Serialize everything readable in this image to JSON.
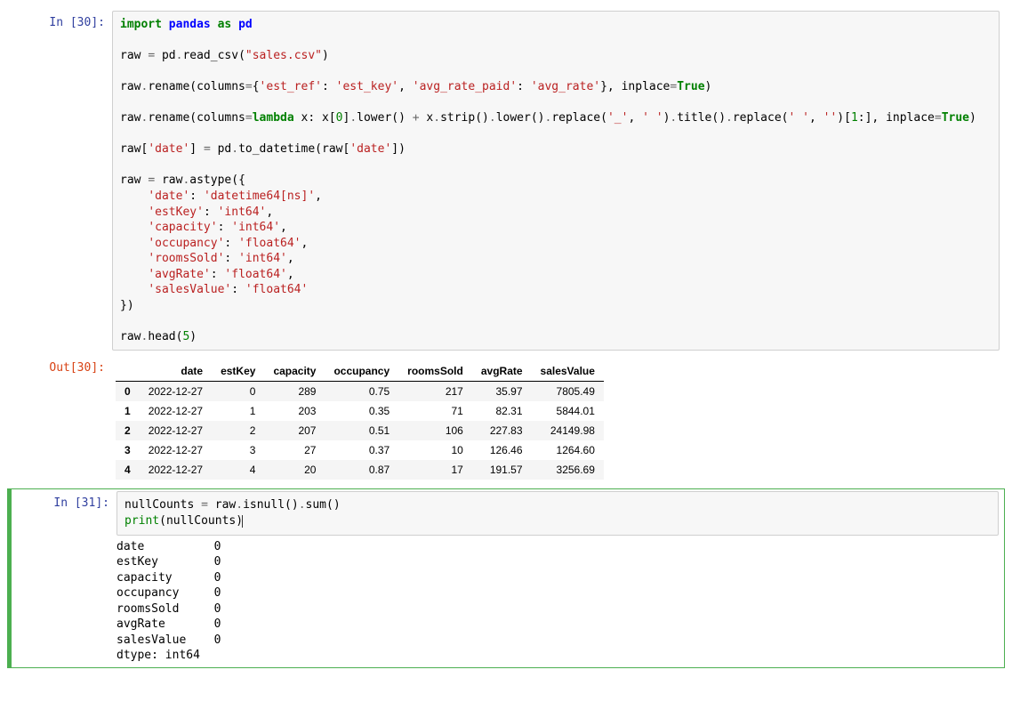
{
  "cells": [
    {
      "in_prompt": "In [30]:",
      "out_prompt": "Out[30]:",
      "code_tokens": [
        [
          "kw",
          "import"
        ],
        [
          "t",
          " "
        ],
        [
          "nn",
          "pandas"
        ],
        [
          "t",
          " "
        ],
        [
          "kw",
          "as"
        ],
        [
          "t",
          " "
        ],
        [
          "nn",
          "pd"
        ],
        [
          "nl",
          ""
        ],
        [
          "nl",
          ""
        ],
        [
          "t",
          "raw "
        ],
        [
          "op",
          "="
        ],
        [
          "t",
          " pd"
        ],
        [
          "op",
          "."
        ],
        [
          "t",
          "read_csv("
        ],
        [
          "str",
          "\"sales.csv\""
        ],
        [
          "t",
          ")"
        ],
        [
          "nl",
          ""
        ],
        [
          "nl",
          ""
        ],
        [
          "t",
          "raw"
        ],
        [
          "op",
          "."
        ],
        [
          "t",
          "rename(columns"
        ],
        [
          "op",
          "="
        ],
        [
          "t",
          "{"
        ],
        [
          "str",
          "'est_ref'"
        ],
        [
          "t",
          ": "
        ],
        [
          "str",
          "'est_key'"
        ],
        [
          "t",
          ", "
        ],
        [
          "str",
          "'avg_rate_paid'"
        ],
        [
          "t",
          ": "
        ],
        [
          "str",
          "'avg_rate'"
        ],
        [
          "t",
          "}, inplace"
        ],
        [
          "op",
          "="
        ],
        [
          "kw2",
          "True"
        ],
        [
          "t",
          ")"
        ],
        [
          "nl",
          ""
        ],
        [
          "nl",
          ""
        ],
        [
          "t",
          "raw"
        ],
        [
          "op",
          "."
        ],
        [
          "t",
          "rename(columns"
        ],
        [
          "op",
          "="
        ],
        [
          "kw",
          "lambda"
        ],
        [
          "t",
          " x: x["
        ],
        [
          "num",
          "0"
        ],
        [
          "t",
          "]"
        ],
        [
          "op",
          "."
        ],
        [
          "t",
          "lower() "
        ],
        [
          "op",
          "+"
        ],
        [
          "t",
          " x"
        ],
        [
          "op",
          "."
        ],
        [
          "t",
          "strip()"
        ],
        [
          "op",
          "."
        ],
        [
          "t",
          "lower()"
        ],
        [
          "op",
          "."
        ],
        [
          "t",
          "replace("
        ],
        [
          "str",
          "'_'"
        ],
        [
          "t",
          ", "
        ],
        [
          "str",
          "' '"
        ],
        [
          "t",
          ")"
        ],
        [
          "op",
          "."
        ],
        [
          "t",
          "title()"
        ],
        [
          "op",
          "."
        ],
        [
          "t",
          "replace("
        ],
        [
          "str",
          "' '"
        ],
        [
          "t",
          ", "
        ],
        [
          "str",
          "''"
        ],
        [
          "t",
          ")["
        ],
        [
          "num",
          "1"
        ],
        [
          "t",
          ":], inplace"
        ],
        [
          "op",
          "="
        ],
        [
          "kw2",
          "True"
        ],
        [
          "t",
          ")"
        ],
        [
          "nl",
          ""
        ],
        [
          "nl",
          ""
        ],
        [
          "t",
          "raw["
        ],
        [
          "str",
          "'date'"
        ],
        [
          "t",
          "] "
        ],
        [
          "op",
          "="
        ],
        [
          "t",
          " pd"
        ],
        [
          "op",
          "."
        ],
        [
          "t",
          "to_datetime(raw["
        ],
        [
          "str",
          "'date'"
        ],
        [
          "t",
          "])"
        ],
        [
          "nl",
          ""
        ],
        [
          "nl",
          ""
        ],
        [
          "t",
          "raw "
        ],
        [
          "op",
          "="
        ],
        [
          "t",
          " raw"
        ],
        [
          "op",
          "."
        ],
        [
          "t",
          "astype({"
        ],
        [
          "nl",
          ""
        ],
        [
          "t",
          "    "
        ],
        [
          "str",
          "'date'"
        ],
        [
          "t",
          ": "
        ],
        [
          "str",
          "'datetime64[ns]'"
        ],
        [
          "t",
          ","
        ],
        [
          "nl",
          ""
        ],
        [
          "t",
          "    "
        ],
        [
          "str",
          "'estKey'"
        ],
        [
          "t",
          ": "
        ],
        [
          "str",
          "'int64'"
        ],
        [
          "t",
          ","
        ],
        [
          "nl",
          ""
        ],
        [
          "t",
          "    "
        ],
        [
          "str",
          "'capacity'"
        ],
        [
          "t",
          ": "
        ],
        [
          "str",
          "'int64'"
        ],
        [
          "t",
          ","
        ],
        [
          "nl",
          ""
        ],
        [
          "t",
          "    "
        ],
        [
          "str",
          "'occupancy'"
        ],
        [
          "t",
          ": "
        ],
        [
          "str",
          "'float64'"
        ],
        [
          "t",
          ","
        ],
        [
          "nl",
          ""
        ],
        [
          "t",
          "    "
        ],
        [
          "str",
          "'roomsSold'"
        ],
        [
          "t",
          ": "
        ],
        [
          "str",
          "'int64'"
        ],
        [
          "t",
          ","
        ],
        [
          "nl",
          ""
        ],
        [
          "t",
          "    "
        ],
        [
          "str",
          "'avgRate'"
        ],
        [
          "t",
          ": "
        ],
        [
          "str",
          "'float64'"
        ],
        [
          "t",
          ","
        ],
        [
          "nl",
          ""
        ],
        [
          "t",
          "    "
        ],
        [
          "str",
          "'salesValue'"
        ],
        [
          "t",
          ": "
        ],
        [
          "str",
          "'float64'"
        ],
        [
          "nl",
          ""
        ],
        [
          "t",
          "})"
        ],
        [
          "nl",
          ""
        ],
        [
          "nl",
          ""
        ],
        [
          "t",
          "raw"
        ],
        [
          "op",
          "."
        ],
        [
          "t",
          "head("
        ],
        [
          "num",
          "5"
        ],
        [
          "t",
          ")"
        ]
      ],
      "dataframe": {
        "columns": [
          "date",
          "estKey",
          "capacity",
          "occupancy",
          "roomsSold",
          "avgRate",
          "salesValue"
        ],
        "index": [
          "0",
          "1",
          "2",
          "3",
          "4"
        ],
        "rows": [
          [
            "2022-12-27",
            "0",
            "289",
            "0.75",
            "217",
            "35.97",
            "7805.49"
          ],
          [
            "2022-12-27",
            "1",
            "203",
            "0.35",
            "71",
            "82.31",
            "5844.01"
          ],
          [
            "2022-12-27",
            "2",
            "207",
            "0.51",
            "106",
            "227.83",
            "24149.98"
          ],
          [
            "2022-12-27",
            "3",
            "27",
            "0.37",
            "10",
            "126.46",
            "1264.60"
          ],
          [
            "2022-12-27",
            "4",
            "20",
            "0.87",
            "17",
            "191.57",
            "3256.69"
          ]
        ]
      }
    },
    {
      "in_prompt": "In [31]:",
      "code_tokens": [
        [
          "t",
          "nullCounts "
        ],
        [
          "op",
          "="
        ],
        [
          "t",
          " raw"
        ],
        [
          "op",
          "."
        ],
        [
          "t",
          "isnull()"
        ],
        [
          "op",
          "."
        ],
        [
          "t",
          "sum()"
        ],
        [
          "nl",
          ""
        ],
        [
          "bi",
          "print"
        ],
        [
          "t",
          "(nullCounts)"
        ],
        [
          "caret",
          ""
        ]
      ],
      "stdout_lines": [
        "date          0",
        "estKey        0",
        "capacity      0",
        "occupancy     0",
        "roomsSold     0",
        "avgRate       0",
        "salesValue    0",
        "dtype: int64"
      ]
    }
  ]
}
